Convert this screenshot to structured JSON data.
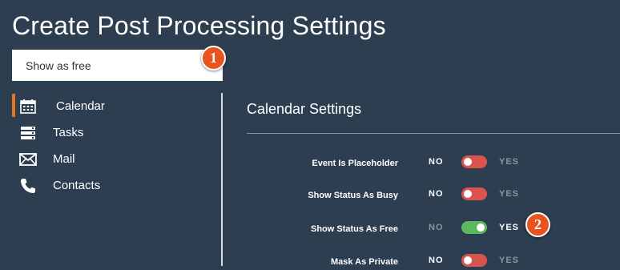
{
  "page": {
    "title": "Create Post Processing Settings"
  },
  "name_field": {
    "value": "Show as free"
  },
  "callouts": [
    "1",
    "2"
  ],
  "sidebar": {
    "items": [
      {
        "label": "Calendar",
        "icon": "calendar-icon",
        "active": true
      },
      {
        "label": "Tasks",
        "icon": "tasks-icon",
        "active": false
      },
      {
        "label": "Mail",
        "icon": "mail-icon",
        "active": false
      },
      {
        "label": "Contacts",
        "icon": "phone-icon",
        "active": false
      }
    ]
  },
  "settings": {
    "title": "Calendar Settings",
    "no_label": "NO",
    "yes_label": "YES",
    "rows": [
      {
        "label": "Event Is Placeholder",
        "value": false
      },
      {
        "label": "Show Status As Busy",
        "value": false
      },
      {
        "label": "Show Status As Free",
        "value": true
      },
      {
        "label": "Mask As Private",
        "value": false
      }
    ]
  },
  "colors": {
    "background": "#2c3e50",
    "accent": "#e8731f",
    "toggle_off": "#d9534f",
    "toggle_on": "#5cb85c",
    "callout": "#e8531f"
  }
}
